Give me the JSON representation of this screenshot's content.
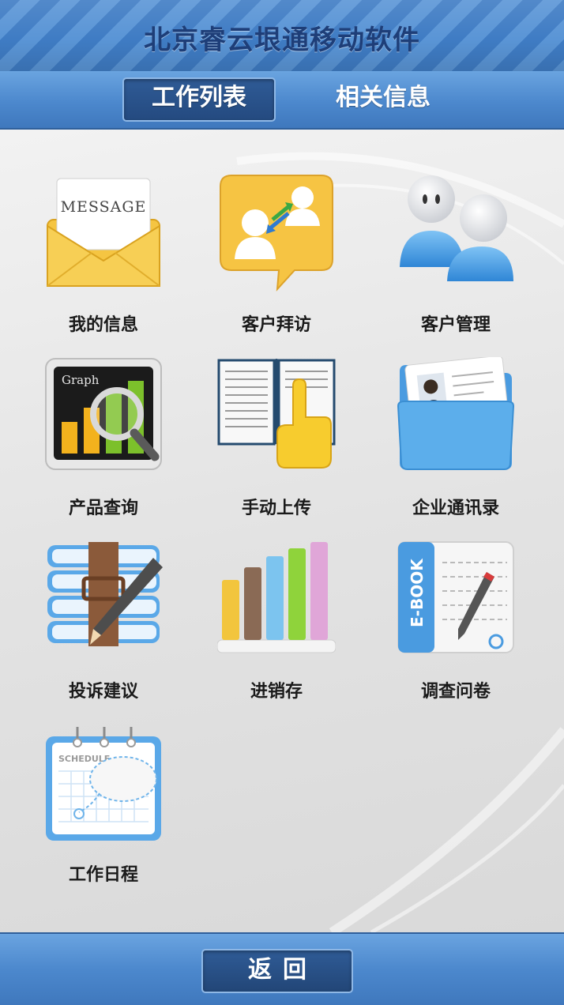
{
  "header": {
    "title": "北京睿云垠通移动软件"
  },
  "tabs": [
    {
      "label": "工作列表",
      "active": true
    },
    {
      "label": "相关信息",
      "active": false
    }
  ],
  "grid": {
    "items": [
      {
        "label": "我的信息",
        "icon": "message-envelope-icon"
      },
      {
        "label": "客户拜访",
        "icon": "customer-visit-icon"
      },
      {
        "label": "客户管理",
        "icon": "customer-management-icon"
      },
      {
        "label": "产品查询",
        "icon": "graph-magnifier-icon"
      },
      {
        "label": "手动上传",
        "icon": "book-hand-icon"
      },
      {
        "label": "企业通讯录",
        "icon": "contact-folder-icon"
      },
      {
        "label": "投诉建议",
        "icon": "books-pencil-icon"
      },
      {
        "label": "进销存",
        "icon": "bar-chart-icon"
      },
      {
        "label": "调查问卷",
        "icon": "ebook-pencil-icon"
      },
      {
        "label": "工作日程",
        "icon": "schedule-calendar-icon"
      }
    ]
  },
  "icon_text": {
    "message": "MESSAGE",
    "graph": "Graph",
    "ebook": "E-BOOK",
    "schedule": "SCHEDULE"
  },
  "footer": {
    "back_label": "返回"
  },
  "colors": {
    "header_blue": "#4c88cd",
    "active_tab": "#2f5b96",
    "label_text": "#1a1a1a"
  }
}
